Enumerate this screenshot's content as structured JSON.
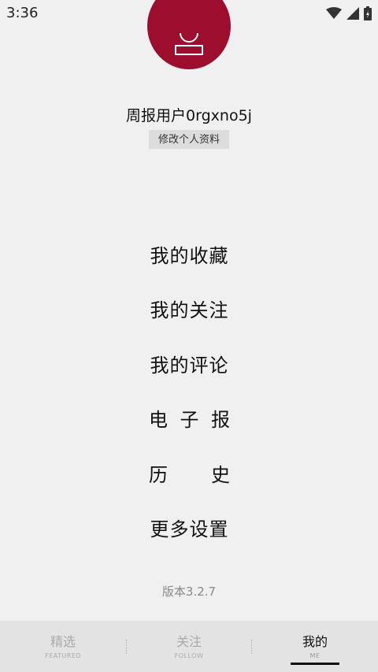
{
  "status_bar": {
    "time": "3:36"
  },
  "profile": {
    "username": "周报用户0rgxno5j",
    "edit_label": "修改个人资料"
  },
  "menu": {
    "items": [
      {
        "label": "我的收藏"
      },
      {
        "label": "我的关注"
      },
      {
        "label": "我的评论"
      },
      {
        "chars": [
          "电",
          "子",
          "报"
        ]
      },
      {
        "chars": [
          "历",
          "史"
        ]
      },
      {
        "label": "更多设置"
      }
    ]
  },
  "version": "版本3.2.7",
  "tabs": [
    {
      "label": "精选",
      "sub": "FEATURED"
    },
    {
      "label": "关注",
      "sub": "FOLLOW"
    },
    {
      "label": "我的",
      "sub": "ME"
    }
  ],
  "colors": {
    "avatar": "#9c0d2e",
    "background": "#f0f0f0",
    "tabbar": "#e3e3e3"
  }
}
